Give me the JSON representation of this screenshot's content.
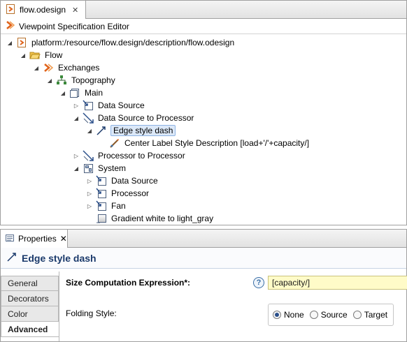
{
  "editor": {
    "tab_label": "flow.odesign",
    "title": "Viewpoint Specification Editor"
  },
  "tree": {
    "nodes": [
      {
        "label": "platform:/resource/flow.design/description/flow.odesign",
        "icon": "odesign-file-icon",
        "twisty": "expanded"
      },
      {
        "label": "Flow",
        "icon": "folder-open-icon",
        "twisty": "expanded"
      },
      {
        "label": "Exchanges",
        "icon": "viewpoint-icon",
        "twisty": "expanded"
      },
      {
        "label": "Topography",
        "icon": "diagram-description-icon",
        "twisty": "expanded"
      },
      {
        "label": "Main",
        "icon": "layer-icon",
        "twisty": "expanded"
      },
      {
        "label": "Data Source",
        "icon": "node-mapping-icon",
        "twisty": "collapsed"
      },
      {
        "label": "Data Source to Processor",
        "icon": "edge-mapping-icon",
        "twisty": "expanded"
      },
      {
        "label": "Edge style  dash",
        "icon": "edge-style-icon",
        "twisty": "expanded",
        "selected": true
      },
      {
        "label": "Center Label Style Description [load+'/'+capacity/]",
        "icon": "label-style-icon",
        "twisty": "none"
      },
      {
        "label": "Processor  to Processor",
        "icon": "edge-mapping-icon",
        "twisty": "collapsed"
      },
      {
        "label": "System",
        "icon": "container-mapping-icon",
        "twisty": "expanded"
      },
      {
        "label": "Data Source",
        "icon": "node-mapping-icon",
        "twisty": "collapsed"
      },
      {
        "label": "Processor",
        "icon": "node-mapping-icon",
        "twisty": "collapsed"
      },
      {
        "label": "Fan",
        "icon": "node-mapping-icon",
        "twisty": "collapsed"
      },
      {
        "label": "Gradient  white to light_gray",
        "icon": "gradient-style-icon",
        "twisty": "none"
      }
    ]
  },
  "properties": {
    "tab_label": "Properties",
    "header_title": "Edge style  dash",
    "side_tabs": [
      "General",
      "Decorators",
      "Color",
      "Advanced"
    ],
    "active_side_tab": "Advanced",
    "size_label": "Size Computation Expression*:",
    "help_glyph": "?",
    "size_value": "[capacity/]",
    "folding_label": "Folding Style:",
    "folding_options": [
      "None",
      "Source",
      "Target"
    ],
    "folding_selected": "None"
  }
}
